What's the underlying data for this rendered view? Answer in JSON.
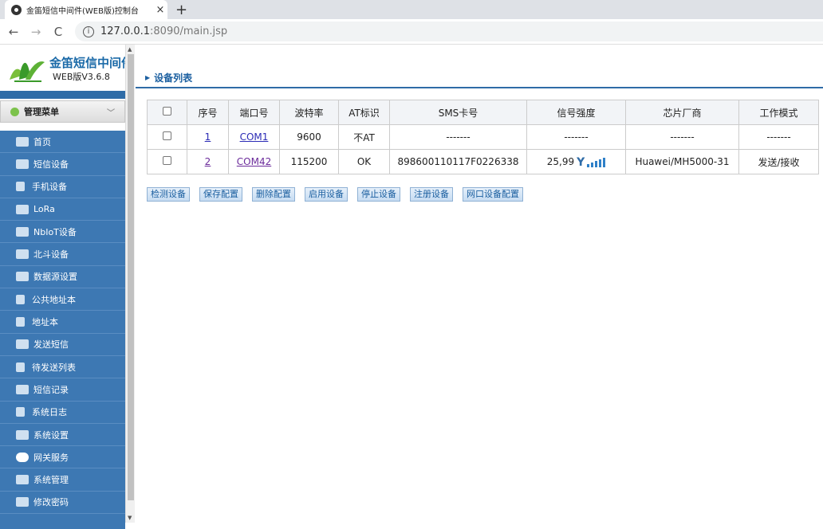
{
  "browser": {
    "tab_title": "金笛短信中间件(WEB版)控制台",
    "tab_close": "×",
    "new_tab": "+",
    "url_host": "127.0.0.1",
    "url_path": ":8090/main.jsp"
  },
  "sidebar": {
    "logo_name": "金笛短信中间件",
    "logo_version": "WEB版V3.6.8",
    "menu_title": "管理菜单",
    "items": [
      {
        "label": "首页",
        "icon": "home-icon"
      },
      {
        "label": "短信设备",
        "icon": "modem-icon"
      },
      {
        "label": "手机设备",
        "icon": "phone-icon"
      },
      {
        "label": "LoRa",
        "icon": "lora-icon"
      },
      {
        "label": "NbIoT设备",
        "icon": "nbiot-icon"
      },
      {
        "label": "北斗设备",
        "icon": "beidou-icon"
      },
      {
        "label": "数据源设置",
        "icon": "database-icon"
      },
      {
        "label": "公共地址本",
        "icon": "public-contacts-icon"
      },
      {
        "label": "地址本",
        "icon": "contacts-icon"
      },
      {
        "label": "发送短信",
        "icon": "mail-icon"
      },
      {
        "label": "待发送列表",
        "icon": "queue-icon"
      },
      {
        "label": "短信记录",
        "icon": "message-icon"
      },
      {
        "label": "系统日志",
        "icon": "log-icon"
      },
      {
        "label": "系统设置",
        "icon": "wrench-icon"
      },
      {
        "label": "网关服务",
        "icon": "cloud-icon"
      },
      {
        "label": "系统管理",
        "icon": "users-icon"
      },
      {
        "label": "修改密码",
        "icon": "lock-icon"
      }
    ]
  },
  "main": {
    "breadcrumb": "设备列表",
    "columns": [
      "序号",
      "端口号",
      "波特率",
      "AT标识",
      "SMS卡号",
      "信号强度",
      "芯片厂商",
      "工作模式"
    ],
    "rows": [
      {
        "index": "1",
        "port": "COM1",
        "baud": "9600",
        "at": "不AT",
        "sms": "-------",
        "signal": "-------",
        "vendor": "-------",
        "mode": "-------"
      },
      {
        "index": "2",
        "port": "COM42",
        "baud": "115200",
        "at": "OK",
        "sms": "898600110117F0226338",
        "signal": "25,99",
        "signal_level": 5,
        "vendor": "Huawei/MH5000-31",
        "mode": "发送/接收"
      }
    ],
    "buttons": [
      "检测设备",
      "保存配置",
      "删除配置",
      "启用设备",
      "停止设备",
      "注册设备",
      "网口设备配置"
    ]
  },
  "colors": {
    "accent": "#2f6ca7",
    "menu_bg": "#3d78b3",
    "link": "#2b2bb5"
  }
}
